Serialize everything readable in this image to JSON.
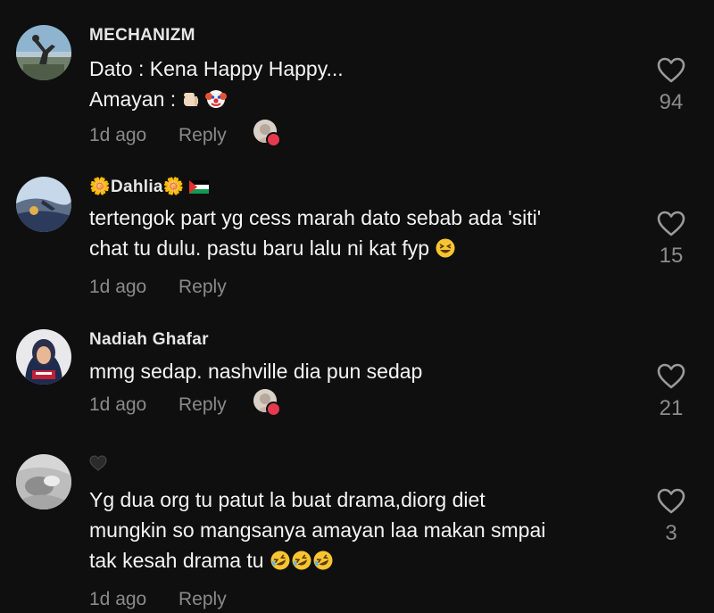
{
  "comments": [
    {
      "username": "MECHANIZM",
      "lines": [
        "Dato : Kena Happy Happy...",
        "Amayan : "
      ],
      "time": "1d ago",
      "reply_label": "Reply",
      "likes": "94",
      "liked_by_creator": true
    },
    {
      "username": "🌼Dahlia🌼",
      "lines": [
        "tertengok part yg cess marah dato sebab ada 'siti'",
        "chat tu dulu. pastu baru lalu ni kat fyp "
      ],
      "time": "1d ago",
      "reply_label": "Reply",
      "likes": "15",
      "liked_by_creator": false
    },
    {
      "username": "Nadiah Ghafar",
      "lines": [
        "mmg sedap. nashville dia pun sedap"
      ],
      "time": "1d ago",
      "reply_label": "Reply",
      "likes": "21",
      "liked_by_creator": true
    },
    {
      "username": "🖤",
      "lines": [
        "Yg dua org tu patut la buat drama,diorg diet",
        "mungkin so mangsanya amayan laa makan smpai",
        "tak kesah drama tu "
      ],
      "time": "1d ago",
      "reply_label": "Reply",
      "likes": "3",
      "liked_by_creator": false
    }
  ],
  "colors": {
    "background": "#0f0f0f",
    "text": "#f4f4f4",
    "muted": "#8a8a8a",
    "badge": "#e53a4e"
  },
  "icons": [
    "heart-outline-icon",
    "thumbs-left-emoji",
    "clown-emoji",
    "grin-squint-emoji",
    "rofl-emoji",
    "palestine-flag-icon",
    "heart-badge-icon"
  ]
}
